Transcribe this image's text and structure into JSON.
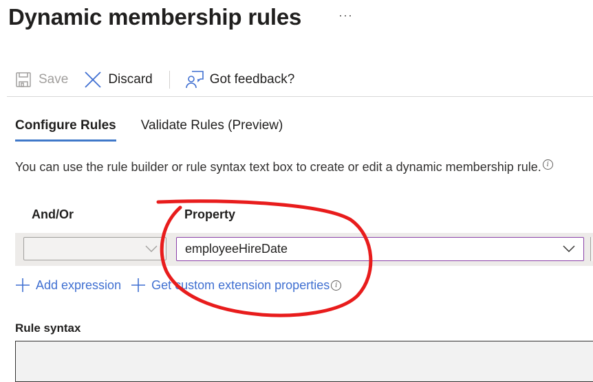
{
  "header": {
    "title": "Dynamic membership rules",
    "more_label": "···"
  },
  "toolbar": {
    "save_label": "Save",
    "discard_label": "Discard",
    "feedback_label": "Got feedback?"
  },
  "tabs": [
    {
      "label": "Configure Rules",
      "active": true
    },
    {
      "label": "Validate Rules (Preview)",
      "active": false
    }
  ],
  "description": "You can use the rule builder or rule syntax text box to create or edit a dynamic membership rule.",
  "rule_builder": {
    "columns": {
      "and_or": "And/Or",
      "property": "Property"
    },
    "rows": [
      {
        "and_or": "",
        "property": "employeeHireDate"
      }
    ]
  },
  "links": {
    "add_expression": "Add expression",
    "custom_extension": "Get custom extension properties"
  },
  "rule_syntax": {
    "label": "Rule syntax",
    "value": ""
  },
  "colors": {
    "accent": "#3f78c9",
    "link": "#3f6fd1",
    "focus_border": "#8a3fa8",
    "annotation": "#e81c1c"
  }
}
